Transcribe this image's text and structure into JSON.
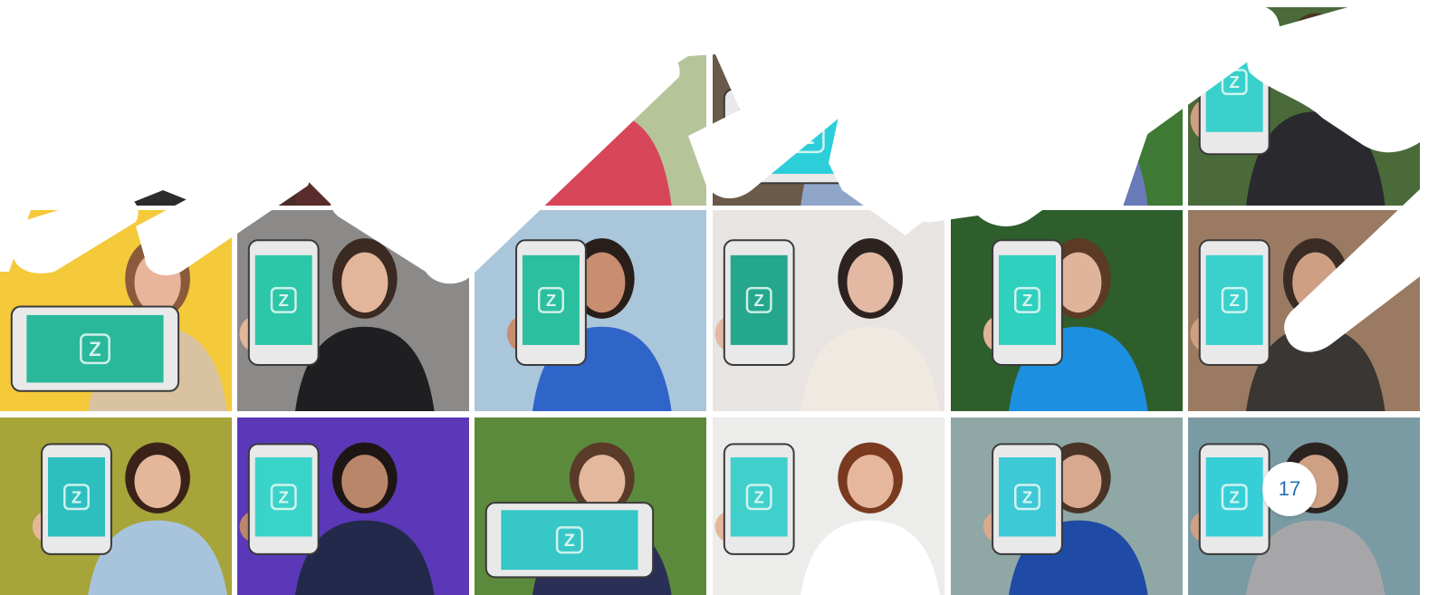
{
  "page_badge": "17",
  "app_logo_letter": "Z",
  "colors": {
    "screen_primary": "#22b8a0",
    "screen_cyan": "#2ccfd9",
    "accent_blue": "#1f6fb5",
    "background": "#ffffff"
  },
  "tiles": [
    {
      "name": "photo-r1-c1",
      "bg": "#f4c93a",
      "skin": "#e8b49a",
      "hair": "#8a5a3a",
      "shirt": "#d9c2a0",
      "screen": "#2ab89b",
      "orient": "landscape"
    },
    {
      "name": "photo-r1-c2",
      "bg": "#8c8a88",
      "skin": "#e3b59a",
      "hair": "#3a2a22",
      "shirt": "#1f1f22",
      "screen": "#2cc6a8",
      "orient": "portrait"
    },
    {
      "name": "photo-r1-c3",
      "bg": "#a9c6db",
      "skin": "#c98e6f",
      "hair": "#2a1e1a",
      "shirt": "#2f64c9",
      "screen": "#2bbf9f",
      "orient": "portrait"
    },
    {
      "name": "photo-r1-c4",
      "bg": "#e7e4e1",
      "skin": "#e3b9a4",
      "hair": "#2c2320",
      "shirt": "#efe9e2",
      "screen": "#24a78c",
      "orient": "portrait"
    },
    {
      "name": "photo-r1-c5",
      "bg": "#2e5e2c",
      "skin": "#e0b49a",
      "hair": "#5b3a26",
      "shirt": "#1d8fe0",
      "screen": "#2fd0be",
      "orient": "portrait"
    },
    {
      "name": "photo-r1-c6",
      "bg": "#9a7a62",
      "skin": "#cf9f83",
      "hair": "#3a2c24",
      "shirt": "#3a3634",
      "screen": "#3ad0cc",
      "orient": "portrait"
    },
    {
      "name": "photo-r2-c1",
      "bg": "#a7a43a",
      "skin": "#e4b79b",
      "hair": "#3b2218",
      "shirt": "#a8c4dc",
      "screen": "#2dbfc0",
      "orient": "portrait"
    },
    {
      "name": "photo-r2-c2",
      "bg": "#5a38b8",
      "skin": "#b9866a",
      "hair": "#1e1614",
      "shirt": "#23294a",
      "screen": "#3ad3c9",
      "orient": "portrait"
    },
    {
      "name": "photo-r2-c3",
      "bg": "#5b8a3c",
      "skin": "#e3b89c",
      "hair": "#5a3a28",
      "shirt": "#2a2f55",
      "screen": "#37c7c6",
      "orient": "landscape"
    },
    {
      "name": "photo-r2-c4",
      "bg": "#ececea",
      "skin": "#e6b79c",
      "hair": "#7a3a20",
      "shirt": "#ffffff",
      "screen": "#3fd0cc",
      "orient": "portrait"
    },
    {
      "name": "photo-r2-c5",
      "bg": "#8fa8a6",
      "skin": "#d8a98f",
      "hair": "#4a3426",
      "shirt": "#1f4aa5",
      "screen": "#3dc9d6",
      "orient": "portrait"
    },
    {
      "name": "photo-r2-c6",
      "bg": "#7a9aa4",
      "skin": "#cfa184",
      "hair": "#2a2320",
      "shirt": "#a6a6a8",
      "screen": "#36cfd7",
      "orient": "portrait"
    },
    {
      "name": "photo-top-c1",
      "bg": "#3a3a3a",
      "skin": "#e0b49a",
      "hair": "#2a1e1a",
      "shirt": "#2c2c2c",
      "screen": "#2ab89b",
      "orient": "portrait"
    },
    {
      "name": "photo-top-c2",
      "bg": "#4a2c26",
      "skin": "#d7a58a",
      "hair": "#6a2c22",
      "shirt": "#5a2c2c",
      "screen": "#2cc6a8",
      "orient": "portrait"
    },
    {
      "name": "photo-top-c3",
      "bg": "#b6c49a",
      "skin": "#d9a68b",
      "hair": "#3a2c24",
      "shirt": "#d8465a",
      "screen": "#2bbf9f",
      "orient": "portrait"
    },
    {
      "name": "photo-top-c4",
      "bg": "#6a5a4a",
      "skin": "#caa184",
      "hair": "#2c2320",
      "shirt": "#8fa6c9",
      "screen": "#2ccfd9",
      "orient": "landscape"
    },
    {
      "name": "photo-top-c5",
      "bg": "#3f7a34",
      "skin": "#d8a98f",
      "hair": "#3a2c24",
      "shirt": "#6a7ab8",
      "screen": "#2fd0be",
      "orient": "portrait"
    },
    {
      "name": "photo-top-c6",
      "bg": "#4a6a3a",
      "skin": "#cf9f83",
      "hair": "#4a3426",
      "shirt": "#2a2a2e",
      "screen": "#3ad0cc",
      "orient": "portrait"
    }
  ]
}
